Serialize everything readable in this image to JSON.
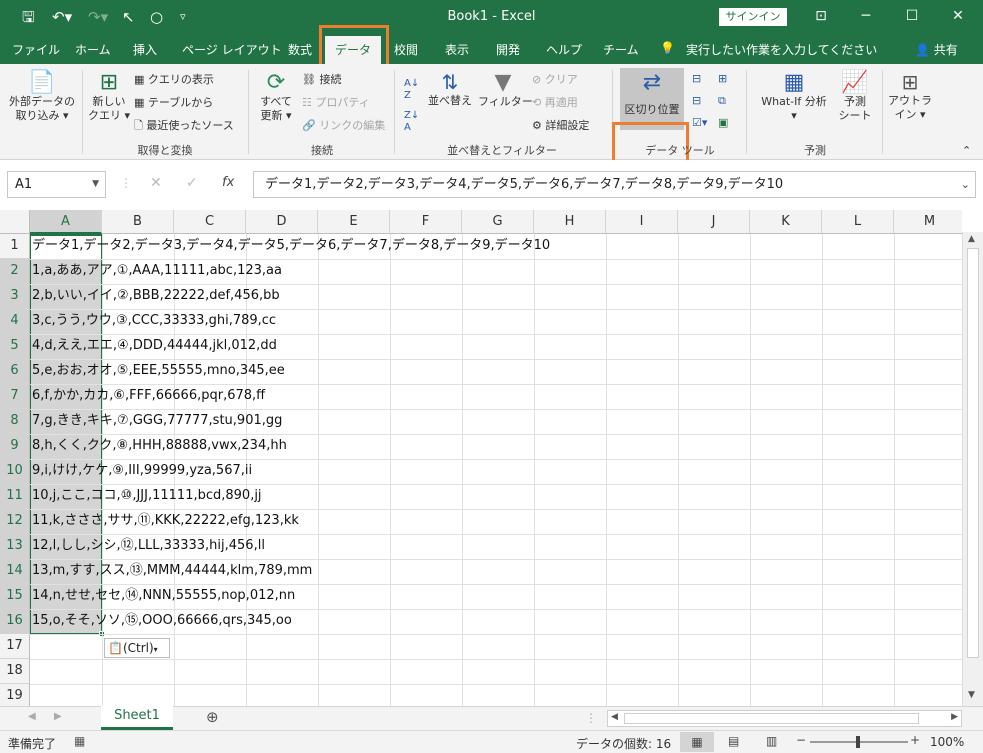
{
  "titlebar": {
    "title": "Book1  -  Excel",
    "signin": "サインイン"
  },
  "menu": {
    "file": "ファイル",
    "home": "ホーム",
    "insert": "挿入",
    "layout": "ページ レイアウト",
    "formulas": "数式",
    "data": "データ",
    "review": "校閲",
    "view": "表示",
    "dev": "開発",
    "help": "ヘルプ",
    "team": "チーム",
    "tellme": "実行したい作業を入力してください",
    "share": "共有"
  },
  "ribbon": {
    "get_external": [
      "外部データの",
      "取り込み ▾"
    ],
    "new_query": [
      "新しい",
      "クエリ ▾"
    ],
    "show_queries": "クエリの表示",
    "from_table": "テーブルから",
    "recent_sources": "最近使ったソース",
    "group_get": "取得と変換",
    "refresh_all": [
      "すべて",
      "更新 ▾"
    ],
    "connections": "接続",
    "properties": "プロパティ",
    "edit_links": "リンクの編集",
    "group_conn": "接続",
    "sort": "並べ替え",
    "filter": "フィルター",
    "clear": "クリア",
    "reapply": "再適用",
    "advanced": "詳細設定",
    "group_sort": "並べ替えとフィルター",
    "text_to_columns": "区切り位置",
    "group_tools": "データ ツール",
    "whatif": "What-If 分析",
    "forecast_sheet": [
      "予測",
      "シート"
    ],
    "group_forecast": "予測",
    "outline": [
      "アウトラ",
      "イン ▾"
    ]
  },
  "formula_bar": {
    "name_box": "A1",
    "content": "データ1,データ2,データ3,データ4,データ5,データ6,データ7,データ8,データ9,データ10"
  },
  "columns": [
    "A",
    "B",
    "C",
    "D",
    "E",
    "F",
    "G",
    "H",
    "I",
    "J",
    "K",
    "L",
    "M"
  ],
  "rows": [
    {
      "n": "1",
      "v": "データ1,データ2,データ3,データ4,データ5,データ6,データ7,データ8,データ9,データ10"
    },
    {
      "n": "2",
      "v": "1,a,ああ,アア,①,AAA,11111,abc,123,aa"
    },
    {
      "n": "3",
      "v": "2,b,いい,イイ,②,BBB,22222,def,456,bb"
    },
    {
      "n": "4",
      "v": "3,c,うう,ウウ,③,CCC,33333,ghi,789,cc"
    },
    {
      "n": "5",
      "v": "4,d,ええ,エエ,④,DDD,44444,jkl,012,dd"
    },
    {
      "n": "6",
      "v": "5,e,おお,オオ,⑤,EEE,55555,mno,345,ee"
    },
    {
      "n": "7",
      "v": "6,f,かか,カカ,⑥,FFF,66666,pqr,678,ff"
    },
    {
      "n": "8",
      "v": "7,g,きき,キキ,⑦,GGG,77777,stu,901,gg"
    },
    {
      "n": "9",
      "v": "8,h,くく,クク,⑧,HHH,88888,vwx,234,hh"
    },
    {
      "n": "10",
      "v": "9,i,けけ,ケケ,⑨,III,99999,yza,567,ii"
    },
    {
      "n": "11",
      "v": "10,j,ここ,ココ,⑩,JJJ,11111,bcd,890,jj"
    },
    {
      "n": "12",
      "v": "11,k,さささ,ササ,⑪,KKK,22222,efg,123,kk"
    },
    {
      "n": "13",
      "v": "12,l,しし,シシ,⑫,LLL,33333,hij,456,ll"
    },
    {
      "n": "14",
      "v": "13,m,すす,スス,⑬,MMM,44444,klm,789,mm"
    },
    {
      "n": "15",
      "v": "14,n,せせ,セセ,⑭,NNN,55555,nop,012,nn"
    },
    {
      "n": "16",
      "v": "15,o,そそ,ソソ,⑮,OOO,66666,qrs,345,oo"
    },
    {
      "n": "17",
      "v": ""
    },
    {
      "n": "18",
      "v": ""
    },
    {
      "n": "19",
      "v": ""
    }
  ],
  "paste_options": "(Ctrl)",
  "sheet_tab": "Sheet1",
  "status": {
    "ready": "準備完了",
    "count": "データの個数: 16",
    "zoom": "100%"
  }
}
